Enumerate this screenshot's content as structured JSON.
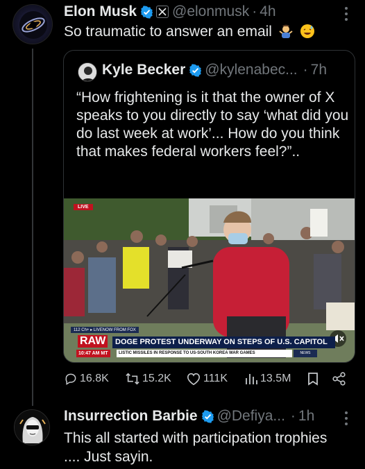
{
  "main_post": {
    "author_name": "Elon Musk",
    "handle": "@elonmusk",
    "separator": "·",
    "time": "4h",
    "text": "So traumatic to answer an email",
    "emojis": [
      "person-shrugging-emoji",
      "sweat-smile-emoji"
    ]
  },
  "quoted_post": {
    "author_name": "Kyle Becker",
    "handle": "@kylenabec...",
    "separator": "·",
    "time": "7h",
    "text": "“How frightening is it that the owner of X speaks to you directly to say ‘what did you do last week at work’... How do you think that makes federal workers feel?”..",
    "video": {
      "live_badge": "LIVE",
      "chyron_small": "112 Ch+  ▸ LIVENOW FROM FOX",
      "raw_label": "RAW",
      "headline": "DOGE PROTEST UNDERWAY ON STEPS OF U.S. CAPITOL",
      "ticker_time": "10:47 AM MT",
      "ticker_text": "LISTIC MISSILES IN RESPONSE TO US-SOUTH KOREA WAR GAMES",
      "news_tag": "NEWS"
    }
  },
  "actions": {
    "replies": "16.8K",
    "reposts": "15.2K",
    "likes": "111K",
    "views": "13.5M"
  },
  "reply_post": {
    "author_name": "Insurrection Barbie",
    "handle": "@Defiya...",
    "separator": "·",
    "time": "1h",
    "text": "This all started with participation trophies .... Just sayin."
  },
  "colors": {
    "background": "#000000",
    "text_primary": "#e7e9ea",
    "text_secondary": "#71767b",
    "verified_blue": "#1d9bf0",
    "border": "#2f3336"
  }
}
